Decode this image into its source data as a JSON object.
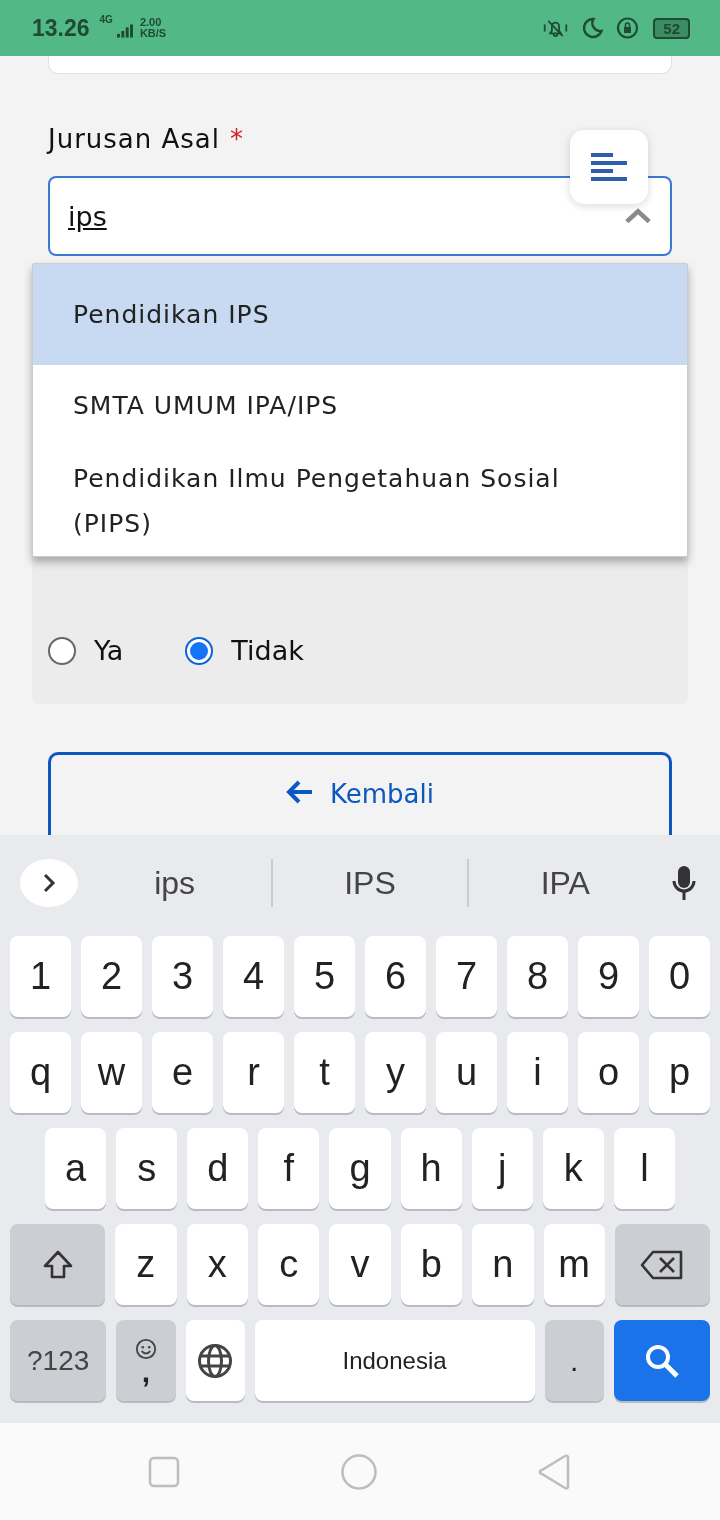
{
  "status_bar": {
    "time": "13.26",
    "network": "4G",
    "speed": "2.00",
    "speed_unit": "KB/S",
    "battery": "52"
  },
  "form": {
    "label": "Jurusan Asal",
    "required_mark": "*",
    "field": {
      "value": "ips",
      "expanded": true
    },
    "options": [
      {
        "label": "Pendidikan IPS",
        "selected": true
      },
      {
        "label": "SMTA UMUM IPA/IPS",
        "selected": false
      },
      {
        "label": "Pendidikan Ilmu Pengetahuan Sosial (PIPS)",
        "selected": false
      }
    ],
    "radios": [
      {
        "label": "Ya",
        "selected": false
      },
      {
        "label": "Tidak",
        "selected": true
      }
    ],
    "back_button": "Kembali"
  },
  "keyboard": {
    "suggestions": [
      "ips",
      "IPS",
      "IPA"
    ],
    "rows": [
      [
        {
          "kind": "letter",
          "label": "1"
        },
        {
          "kind": "letter",
          "label": "2"
        },
        {
          "kind": "letter",
          "label": "3"
        },
        {
          "kind": "letter",
          "label": "4"
        },
        {
          "kind": "letter",
          "label": "5"
        },
        {
          "kind": "letter",
          "label": "6"
        },
        {
          "kind": "letter",
          "label": "7"
        },
        {
          "kind": "letter",
          "label": "8"
        },
        {
          "kind": "letter",
          "label": "9"
        },
        {
          "kind": "letter",
          "label": "0"
        }
      ],
      [
        {
          "kind": "letter",
          "label": "q"
        },
        {
          "kind": "letter",
          "label": "w"
        },
        {
          "kind": "letter",
          "label": "e"
        },
        {
          "kind": "letter",
          "label": "r"
        },
        {
          "kind": "letter",
          "label": "t"
        },
        {
          "kind": "letter",
          "label": "y"
        },
        {
          "kind": "letter",
          "label": "u"
        },
        {
          "kind": "letter",
          "label": "i"
        },
        {
          "kind": "letter",
          "label": "o"
        },
        {
          "kind": "letter",
          "label": "p"
        }
      ],
      [
        {
          "kind": "letter",
          "label": "a"
        },
        {
          "kind": "letter",
          "label": "s"
        },
        {
          "kind": "letter",
          "label": "d"
        },
        {
          "kind": "letter",
          "label": "f"
        },
        {
          "kind": "letter",
          "label": "g"
        },
        {
          "kind": "letter",
          "label": "h"
        },
        {
          "kind": "letter",
          "label": "j"
        },
        {
          "kind": "letter",
          "label": "k"
        },
        {
          "kind": "letter",
          "label": "l"
        }
      ],
      [
        {
          "kind": "shift"
        },
        {
          "kind": "letter",
          "label": "z"
        },
        {
          "kind": "letter",
          "label": "x"
        },
        {
          "kind": "letter",
          "label": "c"
        },
        {
          "kind": "letter",
          "label": "v"
        },
        {
          "kind": "letter",
          "label": "b"
        },
        {
          "kind": "letter",
          "label": "n"
        },
        {
          "kind": "letter",
          "label": "m"
        },
        {
          "kind": "backspace"
        }
      ]
    ],
    "bottom_keys": [
      {
        "kind": "symbols",
        "label": "?123"
      },
      {
        "kind": "comma",
        "label": ","
      },
      {
        "kind": "globe"
      },
      {
        "kind": "space",
        "label": "Indonesia"
      },
      {
        "kind": "period",
        "label": "."
      },
      {
        "kind": "search"
      }
    ]
  }
}
